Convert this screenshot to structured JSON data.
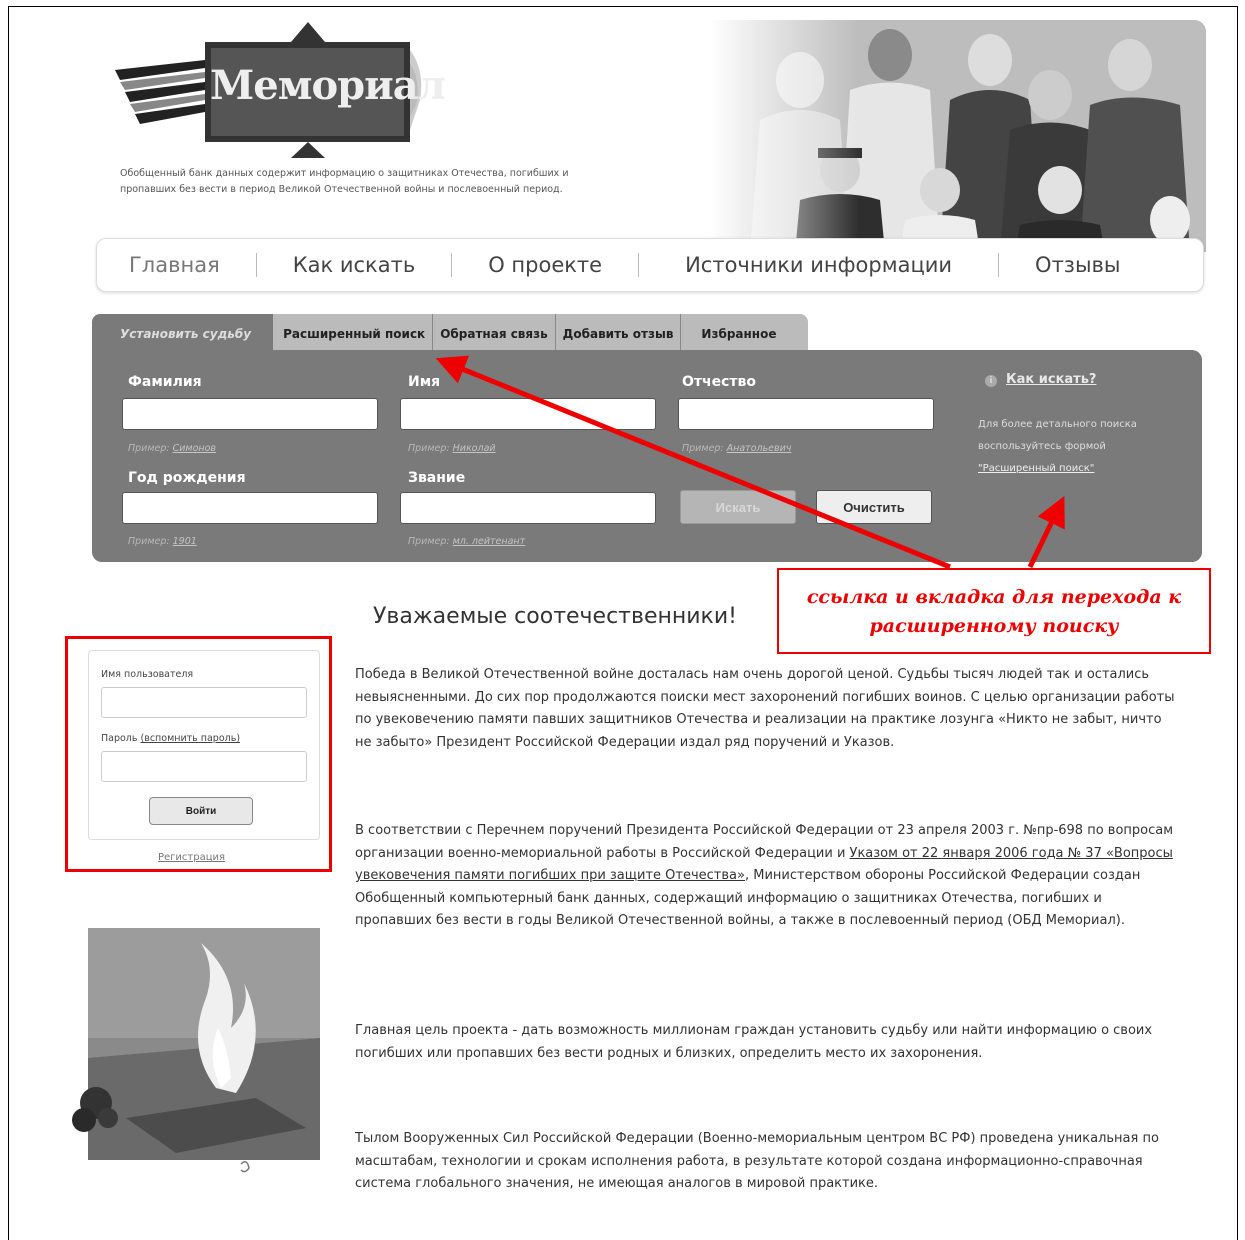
{
  "header": {
    "logo_text": "Мемориал",
    "description": "Обобщенный банк данных содержит информацию о защитниках Отечества, погибших и пропавших без вести в период Великой Отечественной войны и послевоенный период."
  },
  "nav": {
    "items": [
      {
        "label": "Главная"
      },
      {
        "label": "Как искать"
      },
      {
        "label": "О проекте"
      },
      {
        "label": "Источники информации"
      },
      {
        "label": "Отзывы"
      }
    ]
  },
  "search": {
    "tabs": [
      {
        "label": "Установить судьбу",
        "active": true
      },
      {
        "label": "Расширенный поиск"
      },
      {
        "label": "Обратная связь"
      },
      {
        "label": "Добавить отзыв"
      },
      {
        "label": "Избранное"
      }
    ],
    "fields": {
      "surname": {
        "label": "Фамилия",
        "value": "",
        "example_prefix": "Пример:",
        "example": "Симонов"
      },
      "name": {
        "label": "Имя",
        "value": "",
        "example_prefix": "Пример:",
        "example": "Николай"
      },
      "patronymic": {
        "label": "Отчество",
        "value": "",
        "example_prefix": "Пример:",
        "example": "Анатольевич"
      },
      "birth_year": {
        "label": "Год рождения",
        "value": "",
        "example_prefix": "Пример:",
        "example": "1901"
      },
      "rank": {
        "label": "Звание",
        "value": "",
        "example_prefix": "Пример:",
        "example": "мл. лейтенант"
      }
    },
    "search_button": "Искать",
    "clear_button": "Очистить",
    "help": {
      "link": "Как искать?",
      "text_before": "Для более детального поиска воспользуйтесь формой",
      "text_link": "\"Расширенный поиск\""
    }
  },
  "callout": {
    "line1": "ссылка и вкладка для перехода к",
    "line2": "расширенному поиску",
    "color": "#e00000"
  },
  "login": {
    "username_label": "Имя пользователя",
    "username_value": "",
    "password_label": "Пароль",
    "password_remind": "(вспомнить пароль)",
    "password_value": "",
    "login_button": "Войти",
    "register_link": "Регистрация"
  },
  "content": {
    "title": "Уважаемые соотечественники!",
    "p1": "Победа в Великой Отечественной войне досталась нам очень дорогой ценой. Судьбы тысяч людей так и остались невыясненными. До сих пор продолжаются поиски мест захоронений погибших воинов. С целью организации работы по увековечению памяти павших защитников Отечества и реализации на практике лозунга «Никто не забыт, ничто не забыто» Президент Российской Федерации издал ряд поручений и Указов.",
    "p2_before": "В соответствии с Перечнем поручений Президента Российской Федерации от 23 апреля 2003 г. №пр-698 по вопросам организации военно-мемориальной работы в Российской Федерации и ",
    "p2_link": "Указом от 22 января 2006 года № 37 «Вопросы увековечения памяти погибших при защите Отечества»",
    "p2_after": ", Министерством обороны Российской Федерации создан Обобщенный компьютерный банк данных, содержащий информацию о защитниках Отечества, погибших и пропавших без вести в годы Великой Отечественной войны, а также в послевоенный период (ОБД Мемориал).",
    "p3": "Главная цель проекта - дать возможность миллионам граждан установить судьбу или найти информацию о своих погибших или пропавших без вести родных и близких, определить место их захоронения.",
    "p4": "Тылом Вооруженных Сил Российской Федерации (Военно-мемориальным центром ВС РФ) проведена уникальная по масштабам, технологии и срокам исполнения работа, в результате которой создана информационно-справочная система глобального значения, не имеющая аналогов в мировой практике."
  }
}
